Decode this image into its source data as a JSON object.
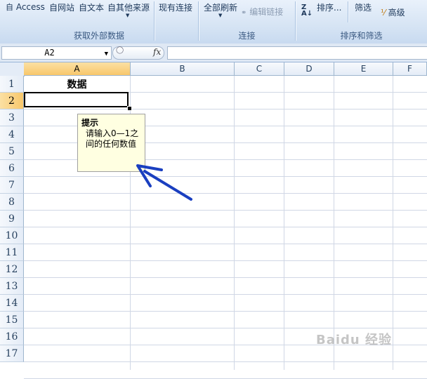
{
  "ribbon": {
    "get_external": {
      "access": "Access",
      "web": "自网站",
      "text": "自文本",
      "other": "自其他来源",
      "existing": "现有连接",
      "label": "获取外部数据"
    },
    "connections": {
      "refresh_all": "全部刷新",
      "edit_links": "编辑链接",
      "label": "连接"
    },
    "sort_filter": {
      "sort": "排序...",
      "filter": "筛选",
      "advanced": "高级",
      "label": "排序和筛选"
    }
  },
  "formula_bar": {
    "name_box": "A2",
    "fx": "fx",
    "value": ""
  },
  "sheet": {
    "columns": [
      "A",
      "B",
      "C",
      "D",
      "E",
      "F"
    ],
    "rows": [
      "1",
      "2",
      "3",
      "4",
      "5",
      "6",
      "7",
      "8",
      "9",
      "10",
      "11",
      "12",
      "13",
      "14",
      "15",
      "16",
      "17"
    ],
    "a1": "数据",
    "selected_cell": "A2"
  },
  "tooltip": {
    "title": "提示",
    "message": "请输入0—1之间的任何数值"
  },
  "watermark": "Baidu 经验"
}
